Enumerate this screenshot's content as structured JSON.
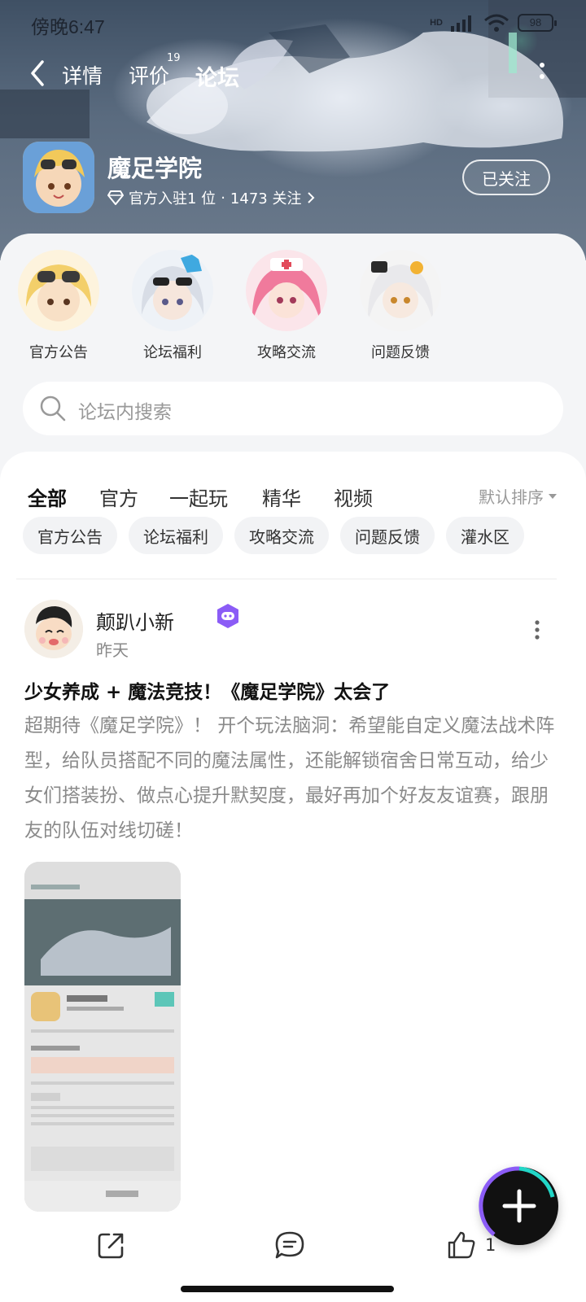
{
  "status_bar": {
    "time": "傍晚6:47",
    "network": "HD",
    "battery": "98"
  },
  "nav": {
    "back_icon": "chevron-left-icon",
    "tabs": [
      {
        "label": "详情"
      },
      {
        "label": "评价",
        "badge": "19"
      },
      {
        "label": "论坛",
        "active": true
      }
    ],
    "more_icon": "more-vertical-icon"
  },
  "game": {
    "name": "魔足学院",
    "rank_text": "官方入驻1 位",
    "separator": "·",
    "followers_text": "1473 关注",
    "follow_button": "已关注"
  },
  "boards": [
    {
      "label": "官方公告"
    },
    {
      "label": "论坛福利"
    },
    {
      "label": "攻略交流"
    },
    {
      "label": "问题反馈"
    }
  ],
  "search": {
    "placeholder": "论坛内搜索"
  },
  "category_tabs": [
    {
      "label": "全部",
      "active": true
    },
    {
      "label": "官方"
    },
    {
      "label": "一起玩"
    },
    {
      "label": "精华"
    },
    {
      "label": "视频"
    }
  ],
  "sort_label": "默认排序",
  "chips": [
    "官方公告",
    "论坛福利",
    "攻略交流",
    "问题反馈",
    "灌水区"
  ],
  "post": {
    "author": "颠趴小新",
    "time": "昨天",
    "title": "少女养成 + 魔法竞技！《魔足学院》太会了",
    "body": "超期待《魔足学院》！ 开个玩法脑洞：希望能自定义魔法战术阵型，给队员搭配不同的魔法属性，还能解锁宿舍日常互动，给少女们搭装扮、做点心提升默契度，最好再加个好友友谊赛，跟朋友的队伍对线切磋！",
    "image_alt": "screenshot-thumbnail"
  },
  "actions": {
    "share_icon": "share-icon",
    "comment_icon": "comment-icon",
    "like_icon": "thumbs-up-icon",
    "like_count": "1"
  },
  "fab_icon": "plus-icon",
  "colors": {
    "accent": "#22d6c7",
    "fab_bg": "#111111",
    "badge": "#8b5cf6"
  }
}
